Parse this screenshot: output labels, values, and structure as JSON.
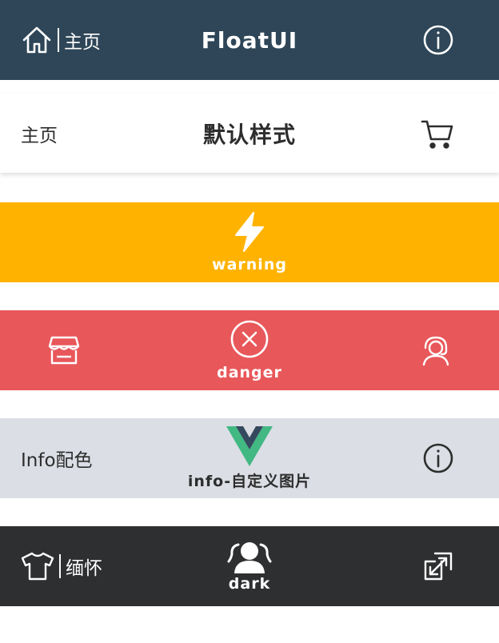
{
  "colors": {
    "primary": "#2e4657",
    "white": "#ffffff",
    "warning": "#ffb300",
    "danger": "#e8575a",
    "info": "#dbdee5",
    "dark": "#2e2f31",
    "text_dark": "#2d2d2d",
    "vue_green": "#42b883",
    "vue_navy": "#35495e"
  },
  "bar1": {
    "left_label": "主页",
    "title": "FloatUI",
    "left_icon": "home-icon",
    "right_icon": "info-circle-icon"
  },
  "bar2": {
    "left_label": "主页",
    "title": "默认样式",
    "right_icon": "cart-icon"
  },
  "bar3": {
    "label": "warning",
    "center_icon": "lightning-icon"
  },
  "bar4": {
    "label": "danger",
    "left_icon": "shop-icon",
    "center_icon": "close-circle-icon",
    "right_icon": "headset-icon"
  },
  "bar5": {
    "left_label": "Info配色",
    "label": "info-自定义图片",
    "center_icon": "vue-logo",
    "right_icon": "info-circle-icon"
  },
  "bar6": {
    "left_label": "缅怀",
    "label": "dark",
    "left_icon": "tshirt-icon",
    "center_icon": "group-icon",
    "right_icon": "external-link-icon"
  }
}
